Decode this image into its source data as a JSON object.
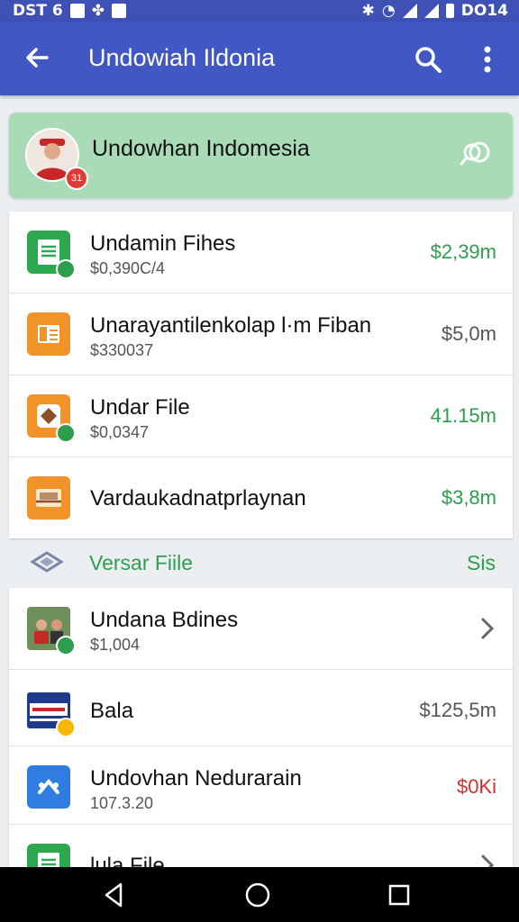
{
  "status_bar": {
    "time_left": "DST 6",
    "time_right": "DO14"
  },
  "app_bar": {
    "title": "Undowiah Ildonia"
  },
  "profile": {
    "name": "Undowhan Indomesia",
    "badge": "31"
  },
  "list_top": [
    {
      "name": "Undamin Fihes",
      "sub": "$0,390C/4",
      "amount": "$2,39m",
      "amount_color": "green",
      "icon_color": "#2ea84f",
      "icon": "document-icon",
      "checked": true
    },
    {
      "name": "Unarayantilenkolap l·m Fiban",
      "sub": "$330037",
      "amount": "$5,0m",
      "amount_color": "gray",
      "icon_color": "#f2932a",
      "icon": "card-icon",
      "checked": false
    },
    {
      "name": "Undar File",
      "sub": "$0,0347",
      "amount": "41.15m",
      "amount_color": "green",
      "icon_color": "#f2932a",
      "icon": "diamond-icon",
      "checked": true
    },
    {
      "name": "Vardaukadnatprlaynan",
      "sub": "",
      "amount": "$3,8m",
      "amount_color": "green",
      "icon_color": "#f2932a",
      "icon": "tray-icon",
      "checked": false
    }
  ],
  "section": {
    "title": "Versar Fiile",
    "meta": "Sis"
  },
  "list_bottom": [
    {
      "name": "Undana Bdines",
      "sub": "$1,004",
      "amount": "",
      "amount_color": "gray",
      "icon": "photo-icon",
      "checked": true,
      "chevron": true
    },
    {
      "name": "Bala",
      "sub": "",
      "amount": "$125,5m",
      "amount_color": "gray",
      "icon": "ticket-icon",
      "checked": false,
      "chevron": false
    },
    {
      "name": "Undovhan Nedurarain",
      "sub": "107.3.20",
      "amount": "$0Ki",
      "amount_color": "red",
      "icon": "app-icon",
      "checked": false,
      "chevron": false
    },
    {
      "name": "lula File",
      "sub": "",
      "amount": "",
      "amount_color": "gray",
      "icon": "sheet-icon",
      "checked": false,
      "chevron": true
    }
  ],
  "colors": {
    "app_bar": "#4158c4",
    "profile_card": "#a8dbb6",
    "accent_green": "#2e9e4e",
    "accent_red": "#d32f2f"
  }
}
